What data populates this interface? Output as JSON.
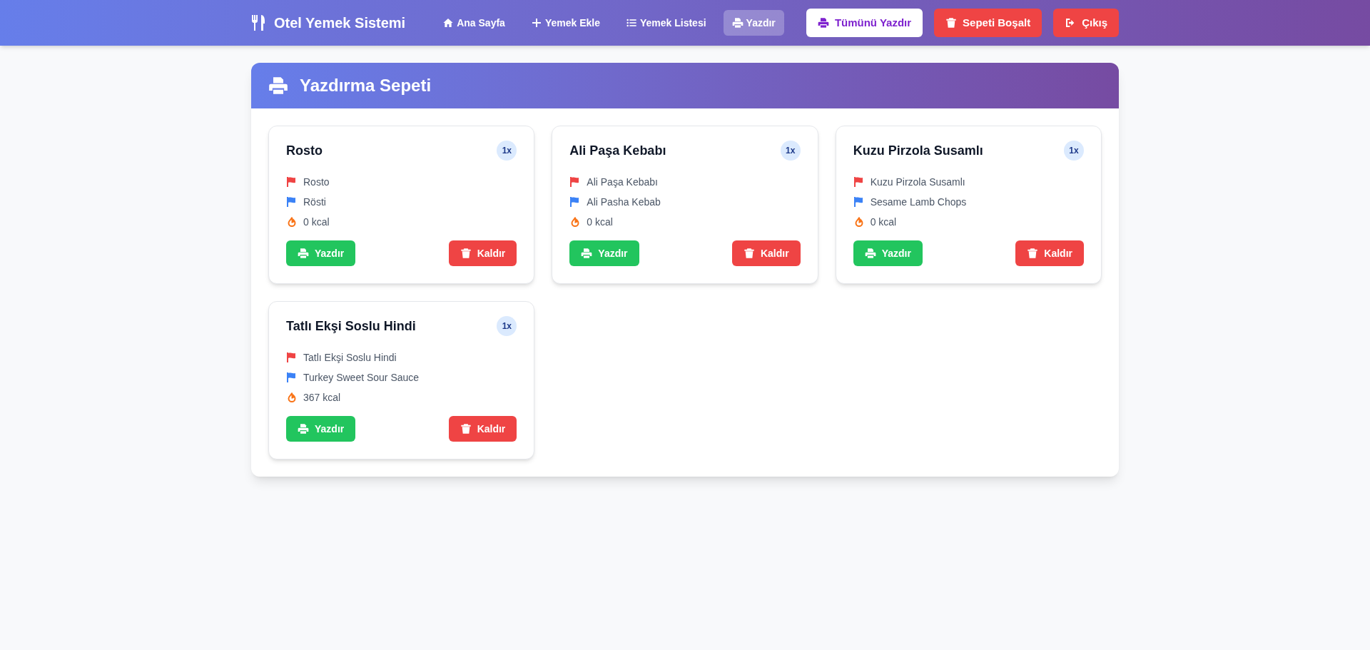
{
  "navbar": {
    "brand": "Otel Yemek Sistemi",
    "links": [
      {
        "kind": "home",
        "label": "Ana Sayfa",
        "selected": false
      },
      {
        "kind": "plus",
        "label": "Yemek Ekle",
        "selected": false
      },
      {
        "kind": "list",
        "label": "Yemek Listesi",
        "selected": false
      },
      {
        "kind": "print",
        "label": "Yazdır",
        "selected": true
      }
    ],
    "actions": [
      {
        "kind": "print",
        "label": "Tümünü Yazdır"
      },
      {
        "kind": "trash",
        "label": "Sepeti Boşalt"
      },
      {
        "kind": "logout",
        "label": "Çıkış"
      }
    ]
  },
  "panel": {
    "title": "Yazdırma Sepeti",
    "items": [
      {
        "name": "Rosto",
        "quantity": "1x",
        "turkish": "Rosto",
        "english": "Rösti",
        "calories": "0 kcal",
        "print_button": "Yazdır",
        "remove_button": "Kaldır"
      },
      {
        "name": "Ali Paşa Kebabı",
        "quantity": "1x",
        "turkish": "Ali Paşa Kebabı",
        "english": "Ali Pasha Kebab",
        "calories": "0 kcal",
        "print_button": "Yazdır",
        "remove_button": "Kaldır"
      },
      {
        "name": "Kuzu Pirzola Susamlı",
        "quantity": "1x",
        "turkish": "Kuzu Pirzola Susamlı",
        "english": "Sesame Lamb Chops",
        "calories": "0 kcal",
        "print_button": "Yazdır",
        "remove_button": "Kaldır"
      },
      {
        "name": "Tatlı Ekşi Soslu Hindi",
        "quantity": "1x",
        "turkish": "Tatlı Ekşi Soslu Hindi",
        "english": "Turkey Sweet Sour Sauce",
        "calories": "367 kcal",
        "print_button": "Yazdır",
        "remove_button": "Kaldır"
      }
    ]
  }
}
